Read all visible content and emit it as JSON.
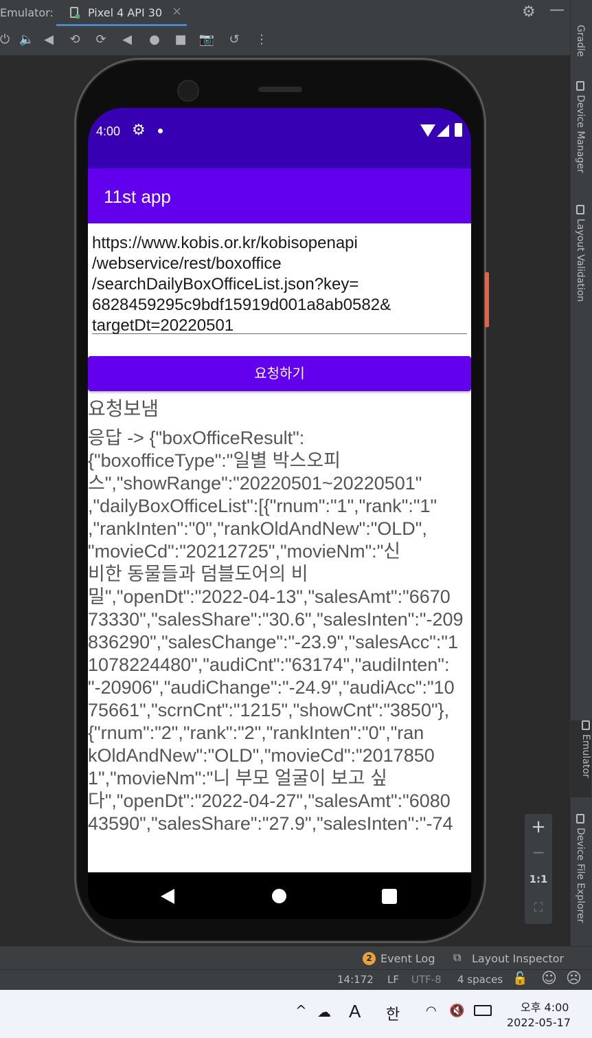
{
  "ide": {
    "window_label": "Emulator:",
    "device_tab": "Pixel 4 API 30",
    "tab_close": "×",
    "right_tabs": [
      "Gradle",
      "Device Manager",
      "Layout Validation",
      "Emulator",
      "Device File Explorer"
    ],
    "zoom": {
      "plus": "+",
      "minus": "−",
      "one_to_one": "1:1"
    },
    "event_log_count": "2",
    "event_log": "Event Log",
    "layout_inspector": "Layout Inspector",
    "status": {
      "position": "14:172",
      "line_sep": "LF",
      "encoding": "UTF-8",
      "indent": "4 spaces"
    }
  },
  "phone": {
    "status_time": "4:00",
    "app_title": "11st app",
    "url_value": "https://www.kobis.or.kr/kobisopenapi\n/webservice/rest/boxoffice\n/searchDailyBoxOfficeList.json?key=\n6828459295c9bdf15919d001a8ab0582&\ntargetDt=20220501",
    "request_button": "요청하기",
    "sent_text": "요청보냄",
    "response_text": "응답 -> {\"boxOfficeResult\":\n{\"boxofficeType\":\"일별 박스오피\n스\",\"showRange\":\"20220501~20220501\"\n,\"dailyBoxOfficeList\":[{\"rnum\":\"1\",\"rank\":\"1\"\n,\"rankInten\":\"0\",\"rankOldAndNew\":\"OLD\",\n\"movieCd\":\"20212725\",\"movieNm\":\"신\n비한 동물들과 덤블도어의 비\n밀\",\"openDt\":\"2022-04-13\",\"salesAmt\":\"6670\n73330\",\"salesShare\":\"30.6\",\"salesInten\":\"-209\n836290\",\"salesChange\":\"-23.9\",\"salesAcc\":\"1\n1078224480\",\"audiCnt\":\"63174\",\"audiInten\":\n\"-20906\",\"audiChange\":\"-24.9\",\"audiAcc\":\"10\n75661\",\"scrnCnt\":\"1215\",\"showCnt\":\"3850\"},\n{\"rnum\":\"2\",\"rank\":\"2\",\"rankInten\":\"0\",\"ran\nkOldAndNew\":\"OLD\",\"movieCd\":\"2017850\n1\",\"movieNm\":\"니 부모 얼굴이 보고 싶\n다\",\"openDt\":\"2022-04-27\",\"salesAmt\":\"6080\n43590\",\"salesShare\":\"27.9\",\"salesInten\":\"-74"
  },
  "taskbar": {
    "font_indicator": "A",
    "ime": "한",
    "ampm_time": "오후 4:00",
    "date": "2022-05-17"
  }
}
